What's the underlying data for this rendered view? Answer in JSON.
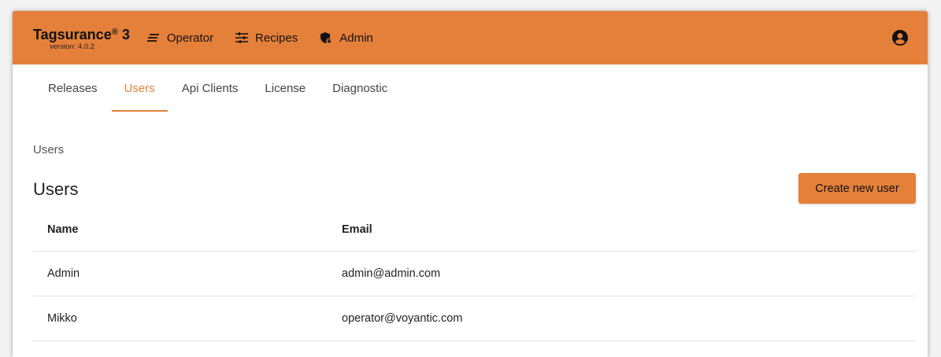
{
  "header": {
    "brand_name": "Tagsurance",
    "brand_registered": "®",
    "brand_number": " 3",
    "version": "version: 4.0.2",
    "nav": [
      {
        "label": "Operator",
        "icon": "lines-icon"
      },
      {
        "label": "Recipes",
        "icon": "sliders-icon"
      },
      {
        "label": "Admin",
        "icon": "shield-lock-icon"
      }
    ],
    "account_icon": "account-circle-icon"
  },
  "tabs": [
    {
      "label": "Releases",
      "active": false
    },
    {
      "label": "Users",
      "active": true
    },
    {
      "label": "Api Clients",
      "active": false
    },
    {
      "label": "License",
      "active": false
    },
    {
      "label": "Diagnostic",
      "active": false
    }
  ],
  "breadcrumb": "Users",
  "page_title": "Users",
  "create_button_label": "Create new user",
  "table": {
    "columns": [
      "Name",
      "Email"
    ],
    "rows": [
      {
        "name": "Admin",
        "email": "admin@admin.com"
      },
      {
        "name": "Mikko",
        "email": "operator@voyantic.com"
      }
    ]
  },
  "colors": {
    "accent": "#e5803a",
    "text": "#222222"
  }
}
